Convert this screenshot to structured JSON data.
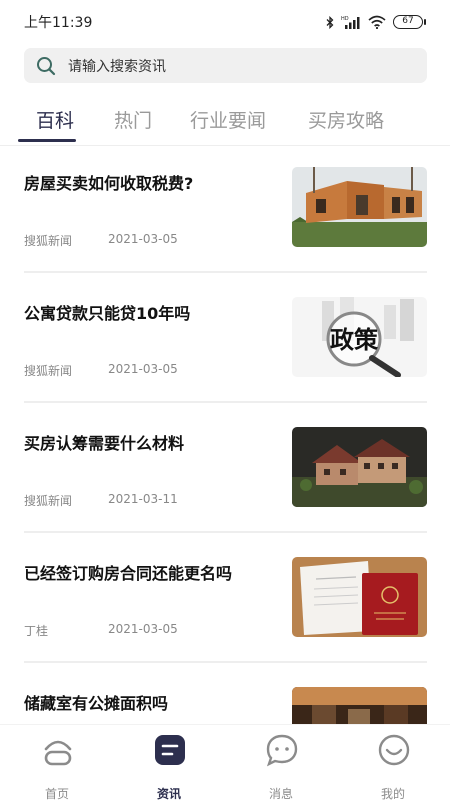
{
  "status_bar": {
    "time": "上午11:39",
    "battery": "67",
    "icons": [
      "bluetooth-icon",
      "hd-signal-icon",
      "wifi-icon",
      "battery-icon"
    ]
  },
  "search": {
    "placeholder": "请输入搜索资讯",
    "icon": "search-icon"
  },
  "tabs": [
    {
      "label": "百科",
      "active": true
    },
    {
      "label": "热门",
      "active": false
    },
    {
      "label": "行业要闻",
      "active": false
    },
    {
      "label": "买房攻略",
      "active": false
    }
  ],
  "articles": [
    {
      "title": "房屋买卖如何收取税费?",
      "source": "搜狐新闻",
      "date": "2021-03-05",
      "thumbnail": "wooden-house-photo"
    },
    {
      "title": "公寓贷款只能贷10年吗",
      "source": "搜狐新闻",
      "date": "2021-03-05",
      "thumbnail": "policy-magnifier-photo",
      "thumb_text": "政策"
    },
    {
      "title": "买房认筹需要什么材料",
      "source": "搜狐新闻",
      "date": "2021-03-11",
      "thumbnail": "building-model-photo"
    },
    {
      "title": "已经签订购房合同还能更名吗",
      "source": "丁桂",
      "date": "2021-03-05",
      "thumbnail": "contract-certificate-photo"
    },
    {
      "title": "储藏室有公摊面积吗",
      "source": "",
      "date": "",
      "thumbnail": "storage-room-photo"
    }
  ],
  "bottom_nav": [
    {
      "label": "首页",
      "icon": "home-icon",
      "active": false
    },
    {
      "label": "资讯",
      "icon": "news-icon",
      "active": true
    },
    {
      "label": "消息",
      "icon": "message-icon",
      "active": false
    },
    {
      "label": "我的",
      "icon": "profile-icon",
      "active": false
    }
  ],
  "colors": {
    "accent": "#2d2f4e",
    "inactive": "#9a9a9a",
    "search_bg": "#f0f0f0",
    "divider": "#eeeeee"
  }
}
